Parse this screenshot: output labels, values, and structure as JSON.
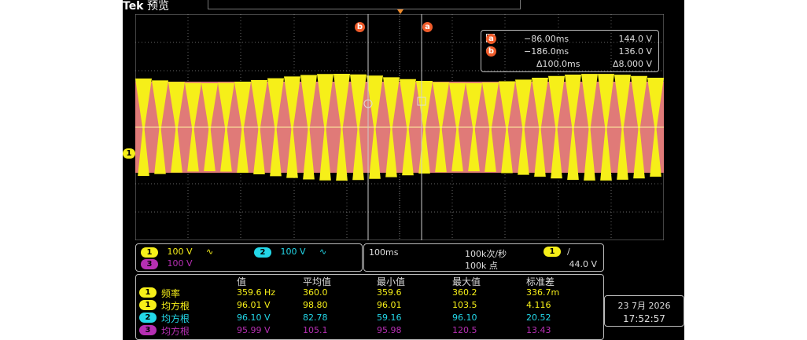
{
  "header": {
    "brand": "Tek",
    "mode": "预览"
  },
  "cursors": {
    "a_label": "a",
    "b_label": "b",
    "row_a": {
      "time": "−86.00ms",
      "volt": "144.0 V"
    },
    "row_b": {
      "time": "−186.0ms",
      "volt": "136.0 V"
    },
    "delta": {
      "time": "Δ100.0ms",
      "volt": "Δ8.000 V"
    }
  },
  "channel_marker": "1",
  "channels": {
    "ch1": {
      "num": "1",
      "scale": "100 V",
      "coupling": "∿",
      "color": "#f6ef19"
    },
    "ch2": {
      "num": "2",
      "scale": "100 V",
      "coupling": "∿",
      "color": "#23d7e8"
    },
    "ch3": {
      "num": "3",
      "scale": "100 V",
      "color": "#b62fb3"
    }
  },
  "timebase": {
    "scale": "100ms",
    "rate": "100k次/秒",
    "points": "100k 点",
    "trigger_channel": "1",
    "trigger_slope": "/",
    "trigger_level": "44.0 V"
  },
  "measurements": {
    "headers": [
      "值",
      "平均值",
      "最小值",
      "最大值",
      "标准差"
    ],
    "rows": [
      {
        "ch": "1",
        "name": "频率",
        "color": "#f6ef19",
        "values": [
          "359.6 Hz",
          "360.0",
          "359.6",
          "360.2",
          "336.7m"
        ]
      },
      {
        "ch": "1",
        "name": "均方根",
        "color": "#f6ef19",
        "values": [
          "96.01 V",
          "98.80",
          "96.01",
          "103.5",
          "4.116"
        ]
      },
      {
        "ch": "2",
        "name": "均方根",
        "color": "#23d7e8",
        "values": [
          "96.10 V",
          "82.78",
          "59.16",
          "96.10",
          "20.52"
        ]
      },
      {
        "ch": "3",
        "name": "均方根",
        "color": "#b62fb3",
        "values": [
          "95.99 V",
          "105.1",
          "95.98",
          "120.5",
          "13.43"
        ]
      }
    ]
  },
  "clock": {
    "date": "23 7月 2026",
    "time": "17:52:57"
  },
  "colors": {
    "ch1": "#f6ef19",
    "ch2": "#23d7e8",
    "ch3": "#b62fb3",
    "trace_pink": "#e07a78",
    "cursor": "#ef5b2a"
  }
}
